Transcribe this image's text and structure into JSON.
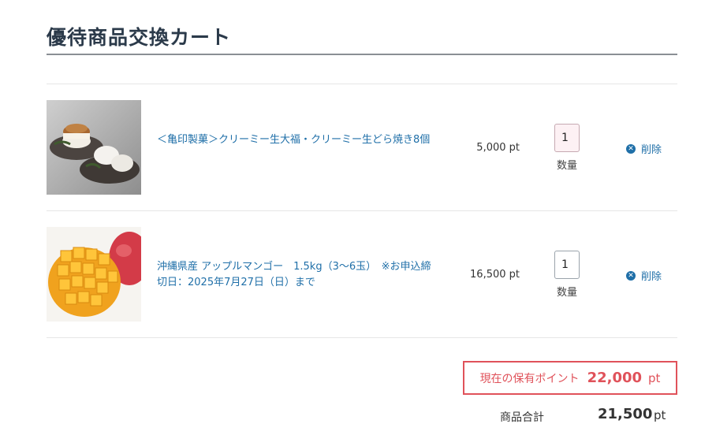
{
  "page": {
    "title": "優待商品交換カート"
  },
  "cart": {
    "items": [
      {
        "name": "＜亀印製菓＞クリーミー生大福・クリーミー生どら焼き8個",
        "price": "5,000 pt",
        "quantity": "1",
        "quantity_label": "数量",
        "delete_label": "削除",
        "image": "dorayaki-daifuku-photo"
      },
      {
        "name": "沖縄県産 アップルマンゴー　1.5kg（3〜6玉）　※お申込締切日：2025年7月27日（日）まで",
        "price": "16,500 pt",
        "quantity": "1",
        "quantity_label": "数量",
        "delete_label": "削除",
        "image": "apple-mango-photo"
      }
    ]
  },
  "summary": {
    "points_label": "現在の保有ポイント",
    "points_value": "22,000",
    "points_unit": "pt",
    "subtotal_label": "商品合計",
    "subtotal_value": "21,500",
    "subtotal_unit": "pt"
  },
  "colors": {
    "link": "#1f6fa8",
    "accent": "#e0525a",
    "title": "#2b3a4a"
  },
  "icons": {
    "delete": "close-circle-icon"
  }
}
